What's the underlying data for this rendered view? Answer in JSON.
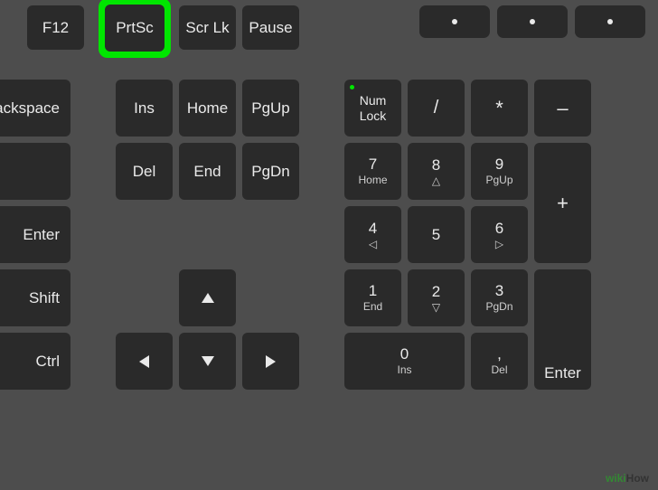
{
  "row0": {
    "f12": "F12",
    "prtsc": "PrtSc",
    "scrlk": "Scr Lk",
    "pause": "Pause"
  },
  "row1": {
    "backspace": "Backspace",
    "ins": "Ins",
    "home": "Home",
    "pgup": "PgUp"
  },
  "row2": {
    "backslash_upper": "|",
    "backslash_lower": "\\",
    "del": "Del",
    "end": "End",
    "pgdn": "PgDn"
  },
  "row3": {
    "enter": "Enter"
  },
  "row4": {
    "shift": "Shift"
  },
  "row5": {
    "ctrl": "Ctrl"
  },
  "numpad": {
    "numlock_l1": "Num",
    "numlock_l2": "Lock",
    "div": "/",
    "mul": "*",
    "sub": "–",
    "add": "+",
    "enter": "Enter",
    "n7": "7",
    "n7_sub": "Home",
    "n8": "8",
    "n9": "9",
    "n9_sub": "PgUp",
    "n4": "4",
    "n5": "5",
    "n6": "6",
    "n1": "1",
    "n1_sub": "End",
    "n2": "2",
    "n3": "3",
    "n3_sub": "PgDn",
    "n0": "0",
    "n0_sub": "Ins",
    "ndot": ",",
    "ndot_sub": "Del"
  },
  "watermark": {
    "wiki": "wiki",
    "how": "How"
  }
}
